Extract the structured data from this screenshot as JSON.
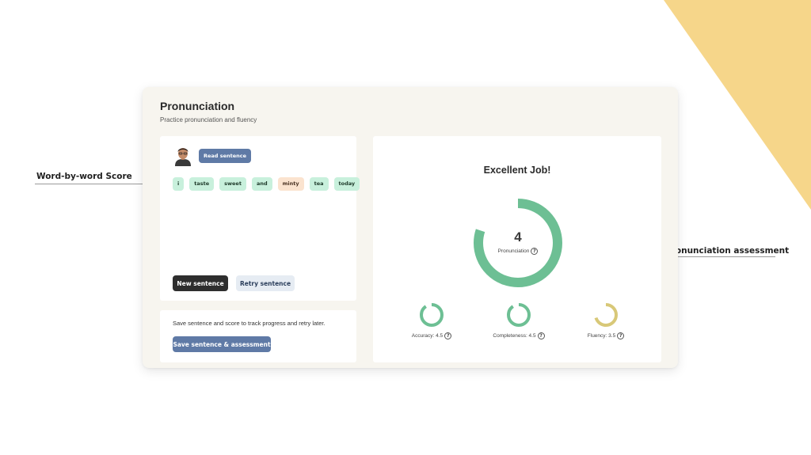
{
  "callouts": {
    "left": "Word-by-word Score",
    "right": "Pronunciation assessment"
  },
  "card": {
    "title": "Pronunciation",
    "subtitle": "Practice pronunciation and fluency"
  },
  "words_panel": {
    "read_button": "Read sentence",
    "words": [
      {
        "text": "i",
        "status": "good"
      },
      {
        "text": "taste",
        "status": "good"
      },
      {
        "text": "sweet",
        "status": "good"
      },
      {
        "text": "and",
        "status": "good"
      },
      {
        "text": "minty",
        "status": "warn"
      },
      {
        "text": "tea",
        "status": "good"
      },
      {
        "text": "today",
        "status": "good"
      }
    ],
    "new_button": "New sentence",
    "retry_button": "Retry sentence"
  },
  "save_panel": {
    "text": "Save sentence and score to track progress and retry later.",
    "button": "Save sentence & assessment"
  },
  "assessment": {
    "headline": "Excellent Job!",
    "pronunciation": {
      "score": "4",
      "label": "Pronunciation",
      "fraction": 0.8,
      "color": "#6dbf94"
    },
    "metrics": [
      {
        "label": "Accuracy: 4.5",
        "fraction": 0.9,
        "color": "#6dbf94"
      },
      {
        "label": "Completeness: 4.5",
        "fraction": 0.9,
        "color": "#6dbf94"
      },
      {
        "label": "Fluency: 3.5",
        "fraction": 0.7,
        "color": "#d8c878"
      }
    ]
  },
  "colors": {
    "accent_blue": "#5f7aa6",
    "good": "#6dbf94",
    "warn": "#d8c878",
    "corner": "#f6d68a"
  }
}
